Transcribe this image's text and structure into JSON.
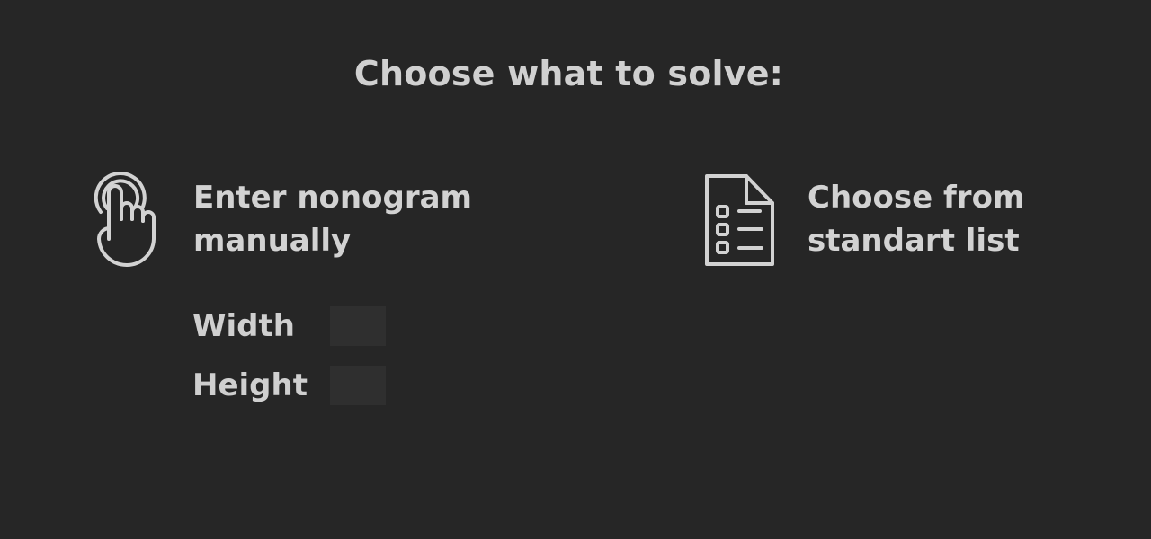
{
  "header": {
    "title": "Choose what to solve:"
  },
  "options": {
    "manual": {
      "icon": "tap-hand-icon",
      "line1": "Enter nonogram",
      "line2": "manually"
    },
    "list": {
      "icon": "list-document-icon",
      "line1": "Choose from",
      "line2": "standart list"
    }
  },
  "dimensions": {
    "width": {
      "label": "Width",
      "value": ""
    },
    "height": {
      "label": "Height",
      "value": ""
    }
  },
  "colors": {
    "background": "#262626",
    "text": "#d2d2d2",
    "input_background": "#2f2f2f"
  }
}
